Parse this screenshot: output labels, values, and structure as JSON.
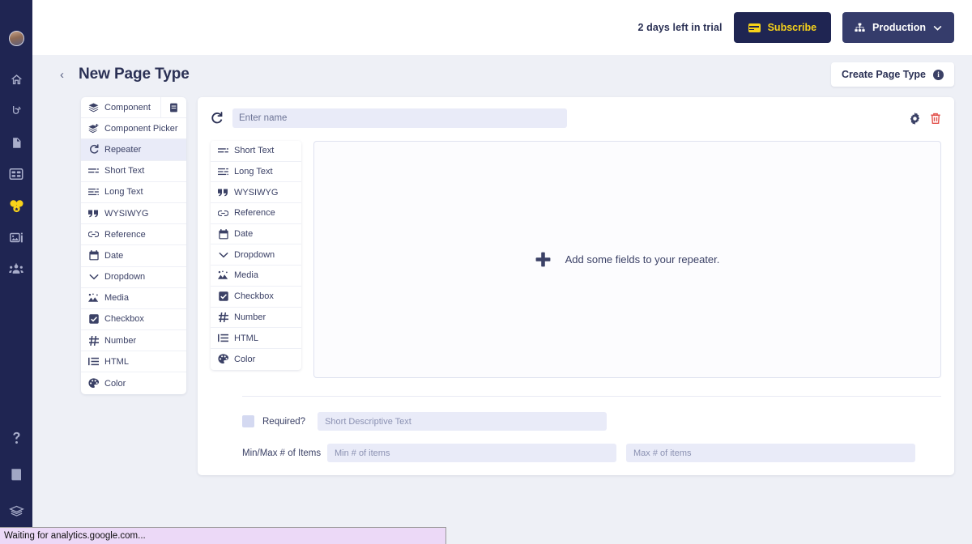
{
  "rail": {
    "avatar_name": "user-avatar",
    "items": [
      {
        "name": "home-icon",
        "label": "Home",
        "active": false
      },
      {
        "name": "broadcast-icon",
        "label": "Broadcast",
        "active": false
      },
      {
        "name": "page-icon",
        "label": "Pages",
        "active": false
      },
      {
        "name": "layout-icon",
        "label": "Layouts",
        "active": false
      },
      {
        "name": "components-icon",
        "label": "Components",
        "active": true
      },
      {
        "name": "media-icon",
        "label": "Media",
        "active": false
      },
      {
        "name": "users-icon",
        "label": "Users",
        "active": false
      }
    ],
    "bottom_items": [
      {
        "name": "help-icon",
        "label": "Help"
      },
      {
        "name": "book-icon",
        "label": "Docs"
      },
      {
        "name": "layers-icon",
        "label": "Layers"
      }
    ]
  },
  "topbar": {
    "trial_text": "2 days left in trial",
    "subscribe_label": "Subscribe",
    "environment_label": "Production"
  },
  "pagehead": {
    "back_label": "‹",
    "title": "New Page Type",
    "create_label": "Create Page Type",
    "info_label": "i"
  },
  "palette": {
    "items": [
      {
        "label": "Component",
        "icon": "stack-icon",
        "selected": false,
        "badge": "book-badge-icon"
      },
      {
        "label": "Component Picker",
        "icon": "stack-plus-icon",
        "selected": false
      },
      {
        "label": "Repeater",
        "icon": "repeat-icon",
        "selected": true
      },
      {
        "label": "Short Text",
        "icon": "short-text-icon",
        "selected": false
      },
      {
        "label": "Long Text",
        "icon": "long-text-icon",
        "selected": false
      },
      {
        "label": "WYSIWYG",
        "icon": "quote-icon",
        "selected": false
      },
      {
        "label": "Reference",
        "icon": "link-icon",
        "selected": false
      },
      {
        "label": "Date",
        "icon": "calendar-icon",
        "selected": false
      },
      {
        "label": "Dropdown",
        "icon": "chevron-down-icon",
        "selected": false
      },
      {
        "label": "Media",
        "icon": "image-icon",
        "selected": false
      },
      {
        "label": "Checkbox",
        "icon": "checkbox-icon",
        "selected": false
      },
      {
        "label": "Number",
        "icon": "hash-icon",
        "selected": false
      },
      {
        "label": "HTML",
        "icon": "list-icon",
        "selected": false
      },
      {
        "label": "Color",
        "icon": "palette-icon",
        "selected": false
      }
    ]
  },
  "card": {
    "name_placeholder": "Enter name",
    "name_value": "",
    "settings_icon": "gear-icon",
    "delete_icon": "trash-icon",
    "field_items": [
      {
        "label": "Short Text",
        "icon": "short-text-icon"
      },
      {
        "label": "Long Text",
        "icon": "long-text-icon"
      },
      {
        "label": "WYSIWYG",
        "icon": "quote-icon"
      },
      {
        "label": "Reference",
        "icon": "link-icon"
      },
      {
        "label": "Date",
        "icon": "calendar-icon"
      },
      {
        "label": "Dropdown",
        "icon": "chevron-down-icon"
      },
      {
        "label": "Media",
        "icon": "image-icon"
      },
      {
        "label": "Checkbox",
        "icon": "checkbox-icon"
      },
      {
        "label": "Number",
        "icon": "hash-icon"
      },
      {
        "label": "HTML",
        "icon": "list-icon"
      },
      {
        "label": "Color",
        "icon": "palette-icon"
      }
    ],
    "dropzone_text": "Add some fields to your repeater.",
    "dropzone_icon": "plus-icon",
    "required_label": "Required?",
    "required_checked": false,
    "desc_placeholder": "Short Descriptive Text",
    "desc_value": "",
    "minmax_label": "Min/Max # of Items",
    "min_placeholder": "Min # of items",
    "min_value": "",
    "max_placeholder": "Max # of items",
    "max_value": ""
  },
  "statusbar": {
    "text": "Waiting for analytics.google.com..."
  },
  "colors": {
    "rail_bg": "#1f2552",
    "accent_yellow": "#f7d21a",
    "page_bg": "#eef0f6",
    "input_bg": "#e9ebf8",
    "selected_row": "#e9ebf8",
    "text_dark": "#2b3155",
    "delete_red": "#e2524c",
    "status_bg": "#ecd9f7"
  }
}
